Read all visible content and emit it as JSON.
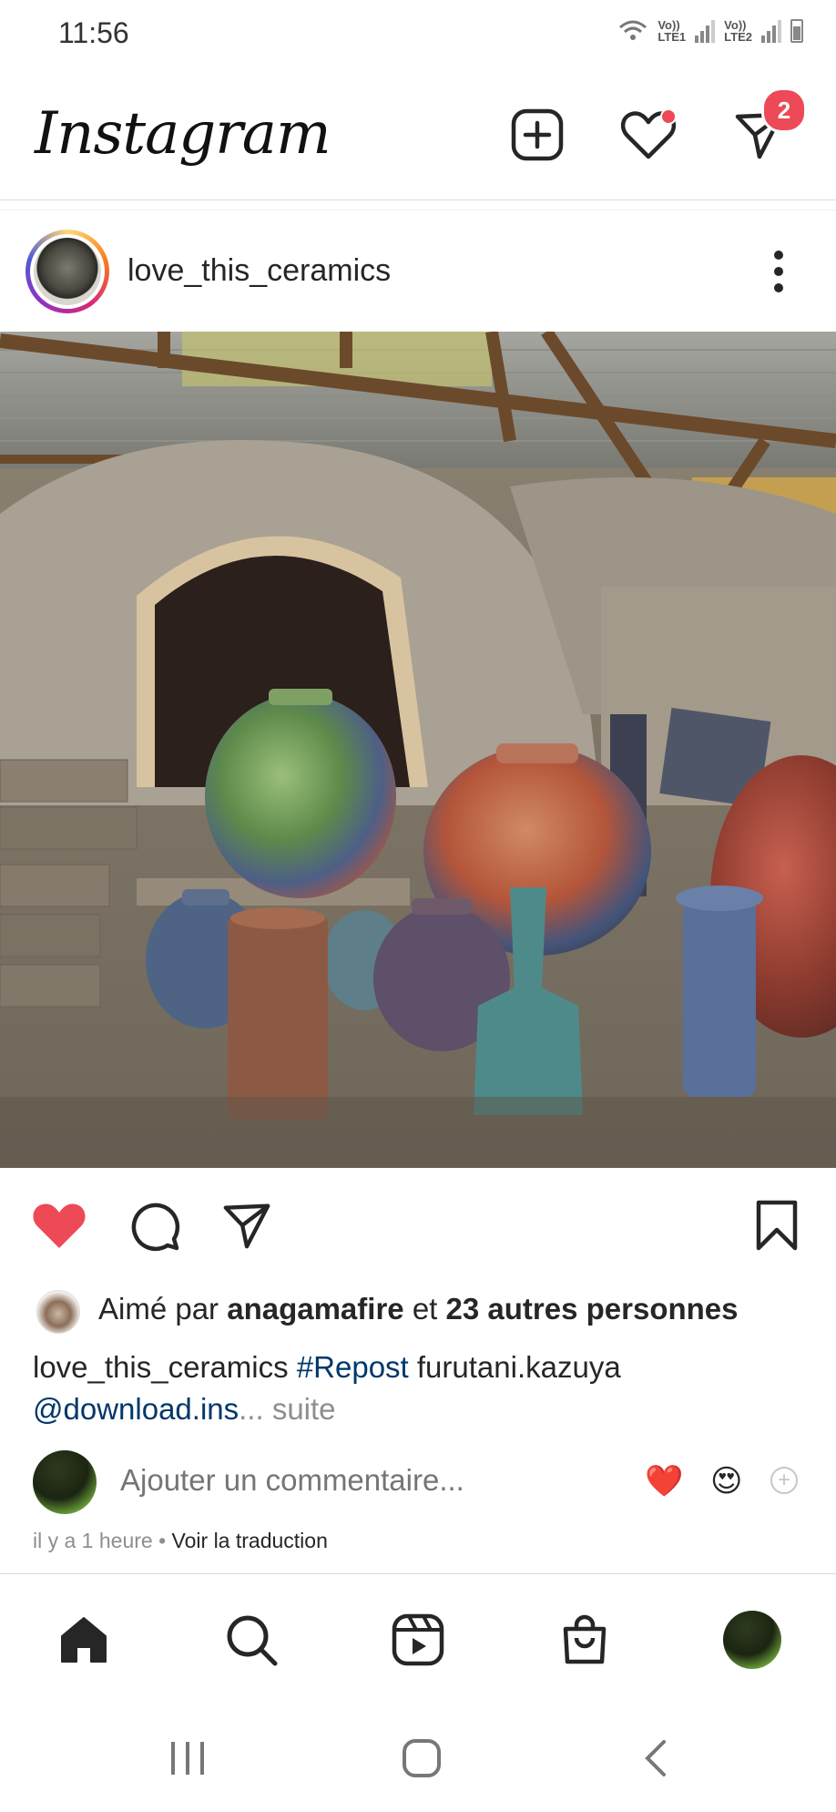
{
  "status_bar": {
    "time": "11:56",
    "sim1": [
      "Vo))",
      "LTE1"
    ],
    "sim2": [
      "Vo))",
      "LTE2"
    ]
  },
  "header": {
    "logo": "Instagram",
    "messages_badge": "2"
  },
  "post": {
    "username": "love_this_ceramics",
    "liked_by_prefix": "Aimé par ",
    "liked_by_user": "anagamafire",
    "liked_by_and": " et ",
    "liked_by_others": "23 autres personnes",
    "caption_user": "love_this_ceramics",
    "caption_hashtag": "#Repost",
    "caption_text": " furutani.kazuya",
    "caption_mention": "@download.ins",
    "caption_ellipsis": "...",
    "caption_more": " suite",
    "comment_placeholder": "Ajouter un commentaire...",
    "quick_emojis": [
      "❤️",
      "😍"
    ],
    "time_ago": "il y a 1 heure",
    "separator": " • ",
    "translate": "Voir la traduction",
    "liked": true
  },
  "colors": {
    "like_red": "#ed4956",
    "link_blue": "#00376b",
    "muted": "#8e8e8e"
  },
  "icons": {
    "header": [
      "new-post-icon",
      "activity-heart-icon",
      "direct-message-icon"
    ],
    "actions": [
      "like-heart-icon",
      "comment-icon",
      "share-icon",
      "bookmark-icon"
    ],
    "bottom_nav": [
      "home-icon",
      "search-icon",
      "reels-icon",
      "shop-icon",
      "profile-avatar"
    ],
    "system_nav": [
      "recents-icon",
      "home-circle-icon",
      "back-icon"
    ]
  }
}
